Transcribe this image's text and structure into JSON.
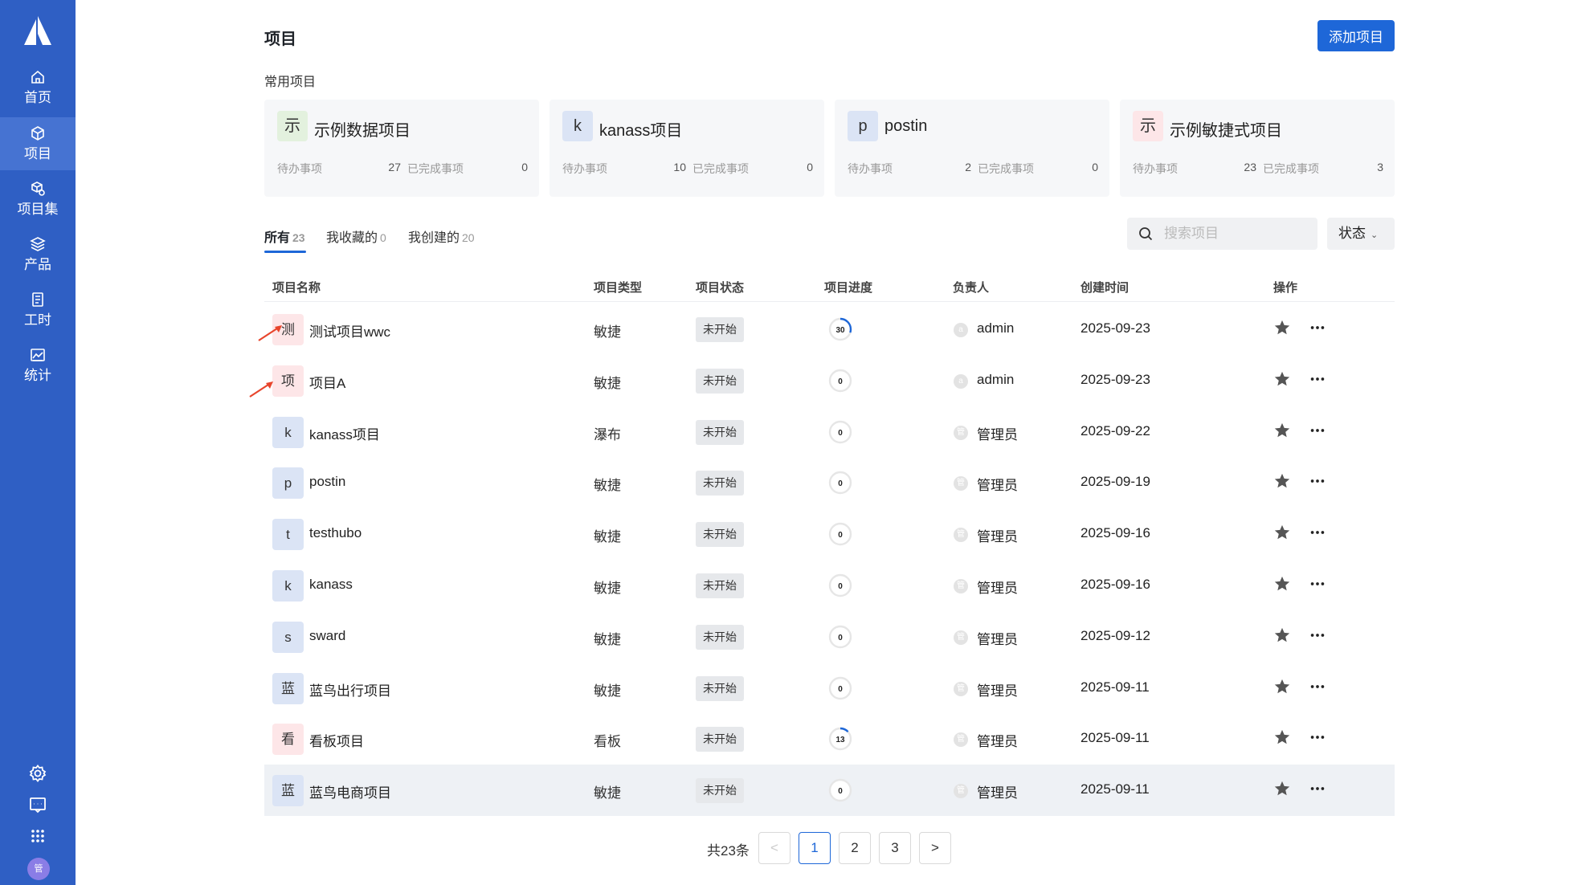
{
  "sidebar": {
    "logo": "logo-icon",
    "items": [
      {
        "label": "首页",
        "icon": "home-icon"
      },
      {
        "label": "项目",
        "icon": "cube-icon",
        "active": true
      },
      {
        "label": "项目集",
        "icon": "cube-collection-icon"
      },
      {
        "label": "产品",
        "icon": "layers-icon"
      },
      {
        "label": "工时",
        "icon": "document-icon"
      },
      {
        "label": "统计",
        "icon": "chart-image-icon"
      }
    ],
    "bottom_icons": [
      "gear-icon",
      "message-icon",
      "apps-grid-icon"
    ],
    "user_avatar": "管"
  },
  "header": {
    "title": "项目",
    "add_button": "添加项目"
  },
  "favorites": {
    "label": "常用项目",
    "cards": [
      {
        "icon": "示",
        "name": "示例数据项目",
        "todo_label": "待办事项",
        "todo": "27",
        "done_label": "已完成事项",
        "done": "0",
        "color": "#e3f1de"
      },
      {
        "icon": "k",
        "name": "kanass项目",
        "todo_label": "待办事项",
        "todo": "10",
        "done_label": "已完成事项",
        "done": "0",
        "color": "#dbe4f5"
      },
      {
        "icon": "p",
        "name": "postin",
        "todo_label": "待办事项",
        "todo": "2",
        "done_label": "已完成事项",
        "done": "0",
        "color": "#dbe4f5"
      },
      {
        "icon": "示",
        "name": "示例敏捷式项目",
        "todo_label": "待办事项",
        "todo": "23",
        "done_label": "已完成事项",
        "done": "3",
        "color": "#fde6e8"
      }
    ]
  },
  "tabs": [
    {
      "label": "所有",
      "count": "23",
      "active": true
    },
    {
      "label": "我收藏的",
      "count": "0"
    },
    {
      "label": "我创建的",
      "count": "20"
    }
  ],
  "search": {
    "placeholder": "搜索项目",
    "icon": "search-icon"
  },
  "status_filter": {
    "label": "状态",
    "icon": "chevron-down-icon"
  },
  "table": {
    "columns": [
      "项目名称",
      "项目类型",
      "项目状态",
      "项目进度",
      "负责人",
      "创建时间",
      "操作"
    ],
    "rows": [
      {
        "icon": "测",
        "color": "#fde6e8",
        "name": "测试项目wwc",
        "type": "敏捷",
        "status": "未开始",
        "progress": 30,
        "owner_avatar": "a",
        "owner": "admin",
        "date": "2025-09-23"
      },
      {
        "icon": "项",
        "color": "#fde6e8",
        "name": "项目A",
        "type": "敏捷",
        "status": "未开始",
        "progress": 0,
        "owner_avatar": "a",
        "owner": "admin",
        "date": "2025-09-23"
      },
      {
        "icon": "k",
        "color": "#dbe4f5",
        "name": "kanass项目",
        "type": "瀑布",
        "status": "未开始",
        "progress": 0,
        "owner_avatar": "管",
        "owner": "管理员",
        "date": "2025-09-22"
      },
      {
        "icon": "p",
        "color": "#dbe4f5",
        "name": "postin",
        "type": "敏捷",
        "status": "未开始",
        "progress": 0,
        "owner_avatar": "管",
        "owner": "管理员",
        "date": "2025-09-19"
      },
      {
        "icon": "t",
        "color": "#dbe4f5",
        "name": "testhubo",
        "type": "敏捷",
        "status": "未开始",
        "progress": 0,
        "owner_avatar": "管",
        "owner": "管理员",
        "date": "2025-09-16"
      },
      {
        "icon": "k",
        "color": "#dbe4f5",
        "name": "kanass",
        "type": "敏捷",
        "status": "未开始",
        "progress": 0,
        "owner_avatar": "管",
        "owner": "管理员",
        "date": "2025-09-16"
      },
      {
        "icon": "s",
        "color": "#dbe4f5",
        "name": "sward",
        "type": "敏捷",
        "status": "未开始",
        "progress": 0,
        "owner_avatar": "管",
        "owner": "管理员",
        "date": "2025-09-12"
      },
      {
        "icon": "蓝",
        "color": "#dbe4f5",
        "name": "蓝鸟出行项目",
        "type": "敏捷",
        "status": "未开始",
        "progress": 0,
        "owner_avatar": "管",
        "owner": "管理员",
        "date": "2025-09-11"
      },
      {
        "icon": "看",
        "color": "#fde6e8",
        "name": "看板项目",
        "type": "看板",
        "status": "未开始",
        "progress": 13,
        "owner_avatar": "管",
        "owner": "管理员",
        "date": "2025-09-11"
      },
      {
        "icon": "蓝",
        "color": "#dbe4f5",
        "name": "蓝鸟电商项目",
        "type": "敏捷",
        "status": "未开始",
        "progress": 0,
        "owner_avatar": "管",
        "owner": "管理员",
        "date": "2025-09-11",
        "highlighted": true
      }
    ],
    "row_actions": [
      "star-icon",
      "more-icon"
    ]
  },
  "pagination": {
    "total": "共23条",
    "pages": [
      "1",
      "2",
      "3"
    ],
    "current": "1",
    "prev": "<",
    "next": ">"
  },
  "colors": {
    "accent": "#1e67d8",
    "sidebar": "#2f5fc4",
    "annotation_arrow": "#e8452c"
  }
}
